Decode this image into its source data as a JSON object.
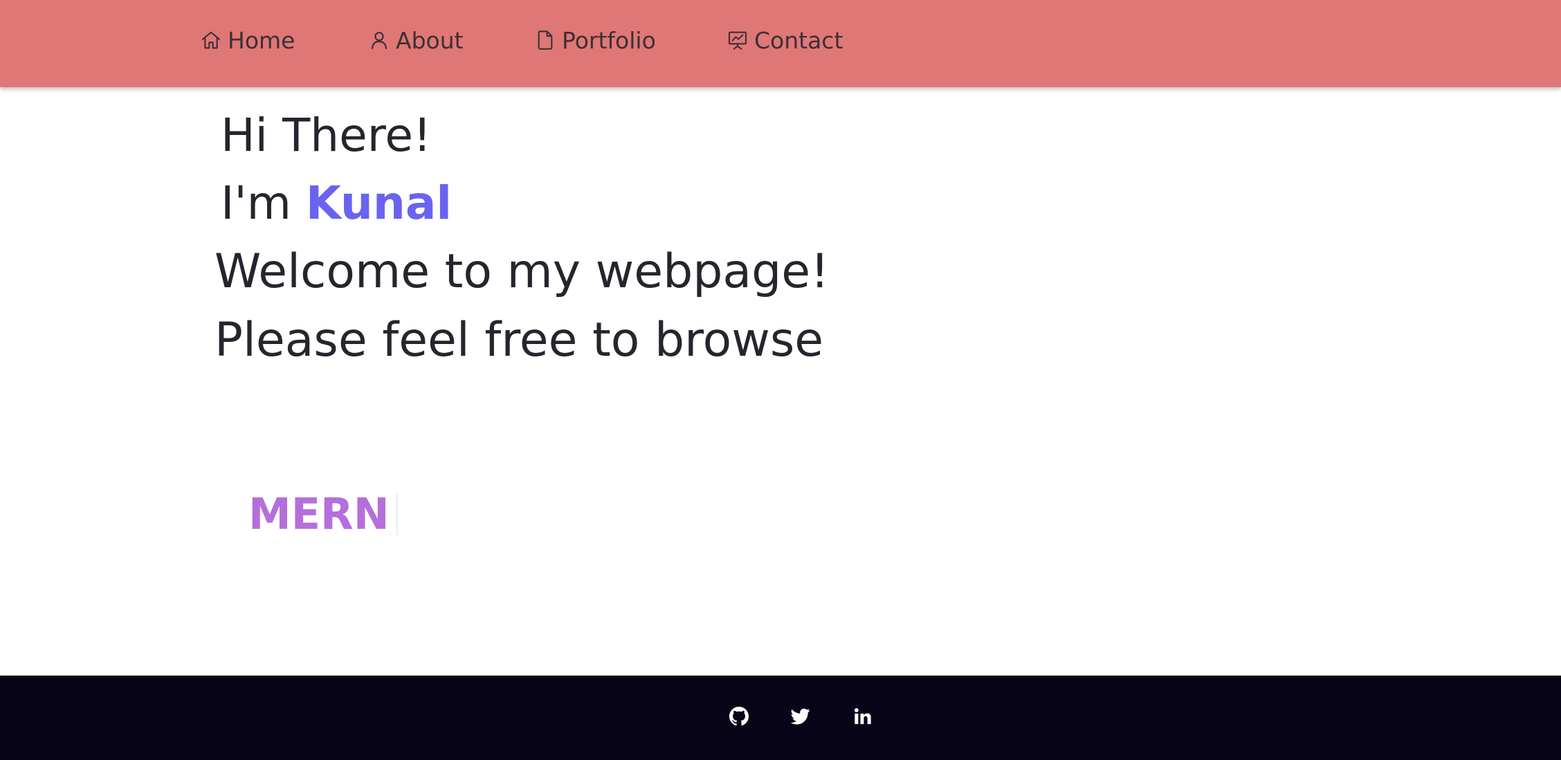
{
  "nav": {
    "items": [
      {
        "label": "Home",
        "icon": "home-icon"
      },
      {
        "label": "About",
        "icon": "user-icon"
      },
      {
        "label": "Portfolio",
        "icon": "document-icon"
      },
      {
        "label": "Contact",
        "icon": "presentation-chart-icon"
      }
    ],
    "background_color": "#e07777",
    "text_color": "#3c3034"
  },
  "hero": {
    "greeting": "Hi There!",
    "intro_prefix": "I'm",
    "name": "Kunal",
    "welcome": "Welcome to my webpage!",
    "browse": "Please feel free to browse",
    "name_color": "#6a63f0",
    "text_color": "#25262d"
  },
  "typewriter": {
    "text": "MERN",
    "color": "#b56fdc"
  },
  "footer": {
    "background_color": "#090518",
    "social": [
      {
        "icon": "github-icon"
      },
      {
        "icon": "twitter-icon"
      },
      {
        "icon": "linkedin-icon"
      }
    ]
  }
}
